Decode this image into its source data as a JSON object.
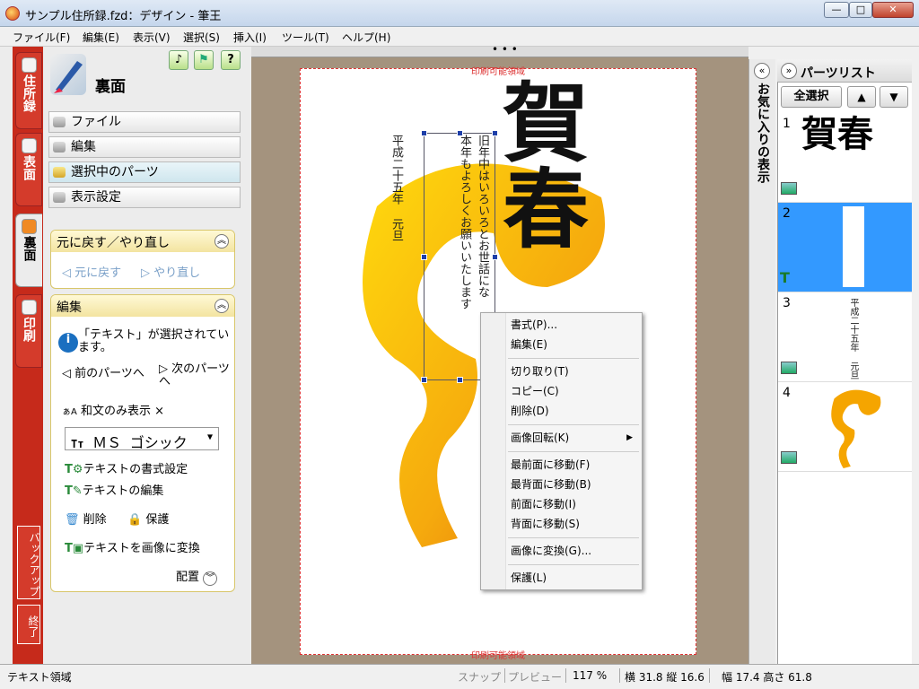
{
  "window": {
    "title": "サンプル住所録.fzd：デザイン - 筆王"
  },
  "menu": [
    "ファイル(F)",
    "編集(E)",
    "表示(V)",
    "選択(S)",
    "挿入(I)",
    "ツール(T)",
    "ヘルプ(H)"
  ],
  "vtabs": {
    "address": "住所録",
    "front": "表面",
    "back": "裏面",
    "print": "印刷",
    "backup": "バックアップ",
    "exit": "終了"
  },
  "side": {
    "title": "裏面",
    "nav": {
      "file": "ファイル",
      "edit": "編集",
      "selected": "選択中のパーツ",
      "display": "表示設定"
    },
    "undo": {
      "header": "元に戻す／やり直し",
      "undo": "元に戻す",
      "redo": "やり直し"
    },
    "edit": {
      "header": "編集",
      "info": "「テキスト」が選択されています。",
      "prev": "前のパーツへ",
      "next": "次のパーツへ",
      "wabun": "和文のみ表示 ×",
      "font": "ＭＳ ゴシック",
      "text_format": "テキストの書式設定",
      "text_edit": "テキストの編集",
      "delete": "削除",
      "protect": "保護",
      "to_image": "テキストを画像に変換",
      "layout": "配置"
    }
  },
  "canvas": {
    "print_area_label": "印刷可能領域",
    "greeting_line1": "旧年中はいろいろとお世話にな",
    "greeting_line2": "本年もよろしくお願いいたします",
    "date": "平成二十五年 元旦",
    "kanji": "賀春"
  },
  "context_menu": [
    "書式(P)...",
    "編集(E)",
    "切り取り(T)",
    "コピー(C)",
    "削除(D)",
    "画像回転(K)",
    "最前面に移動(F)",
    "最背面に移動(B)",
    "前面に移動(I)",
    "背面に移動(S)",
    "画像に変換(G)...",
    "保護(L)"
  ],
  "favorites": {
    "label": "お気に入りの表示"
  },
  "parts": {
    "title": "パーツリスト",
    "select_all": "全選択",
    "numbers": [
      "1",
      "2",
      "3",
      "4"
    ],
    "date_text": "平成二十五年 元旦"
  },
  "status": {
    "left": "テキスト領域",
    "snap": "スナップ",
    "preview": "プレビュー",
    "zoom": "117 %",
    "pos": "横 31.8 縦 16.6",
    "size": "幅 17.4 高さ 61.8"
  },
  "colors": {
    "accent_red": "#c62a1b",
    "selection": "#3399ff",
    "print_area": "#dd3333"
  }
}
